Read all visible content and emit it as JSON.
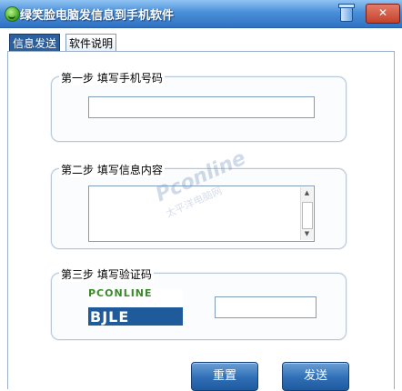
{
  "window": {
    "title": "绿笑脸电脑发信息到手机软件",
    "close_label": "✕"
  },
  "tabs": [
    {
      "label": "信息发送",
      "active": true
    },
    {
      "label": "软件说明",
      "active": false
    }
  ],
  "steps": {
    "step1": {
      "label": "第一步 填写手机号码",
      "value": ""
    },
    "step2": {
      "label": "第二步 填写信息内容",
      "value": ""
    },
    "step3": {
      "label": "第三步 填写验证码",
      "value": "",
      "captcha_top": "PCONLINE",
      "captcha_bottom": "BJLE"
    }
  },
  "buttons": {
    "reset": "重置",
    "send": "发送"
  },
  "watermark": {
    "main": "Pconline",
    "sub": "太平洋电脑网"
  },
  "colors": {
    "titlebar": "#2f72c4",
    "button": "#2f6fb6",
    "active_tab": "#2c5f9e"
  }
}
